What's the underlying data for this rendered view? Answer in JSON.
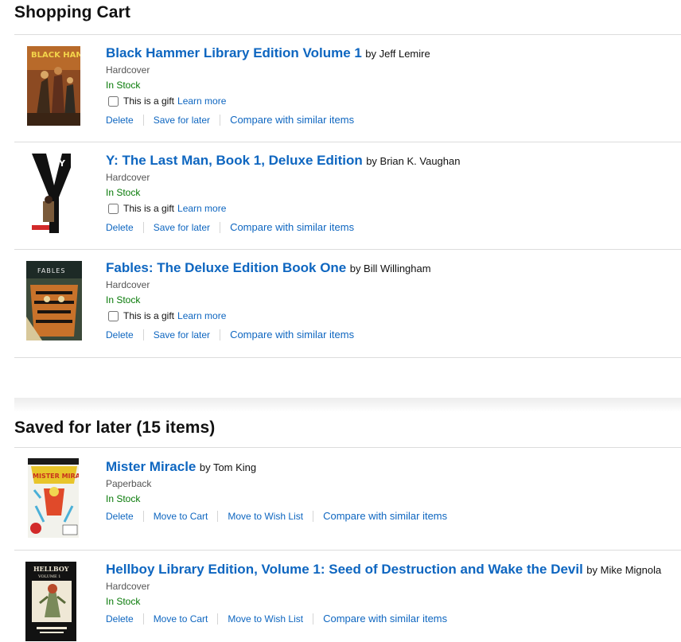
{
  "cart": {
    "heading": "Shopping Cart",
    "items": [
      {
        "title": "Black Hammer Library Edition Volume 1",
        "author": "by Jeff Lemire",
        "format": "Hardcover",
        "stock": "In Stock",
        "gift_label": "This is a gift",
        "learn_more": "Learn more",
        "delete": "Delete",
        "save_later": "Save for later",
        "compare": "Compare with similar items"
      },
      {
        "title": "Y: The Last Man, Book 1, Deluxe Edition",
        "author": "by Brian K. Vaughan",
        "format": "Hardcover",
        "stock": "In Stock",
        "gift_label": "This is a gift",
        "learn_more": "Learn more",
        "delete": "Delete",
        "save_later": "Save for later",
        "compare": "Compare with similar items"
      },
      {
        "title": "Fables: The Deluxe Edition Book One",
        "author": "by Bill Willingham",
        "format": "Hardcover",
        "stock": "In Stock",
        "gift_label": "This is a gift",
        "learn_more": "Learn more",
        "delete": "Delete",
        "save_later": "Save for later",
        "compare": "Compare with similar items"
      }
    ]
  },
  "saved": {
    "heading": "Saved for later (15 items)",
    "items": [
      {
        "title": "Mister Miracle",
        "author": "by Tom King",
        "format": "Paperback",
        "stock": "In Stock",
        "delete": "Delete",
        "move_cart": "Move to Cart",
        "move_wish": "Move to Wish List",
        "compare": "Compare with similar items"
      },
      {
        "title": "Hellboy Library Edition, Volume 1: Seed of Destruction and Wake the Devil",
        "author": "by Mike Mignola",
        "format": "Hardcover",
        "stock": "In Stock",
        "delete": "Delete",
        "move_cart": "Move to Cart",
        "move_wish": "Move to Wish List",
        "compare": "Compare with similar items"
      }
    ]
  },
  "covers": {
    "black_hammer": "BLACK HAMMER",
    "y_last_man": "Y",
    "fables": "FABLES",
    "mister_miracle": "MISTER MIRACLE",
    "hellboy": "HELLBOY",
    "hellboy_volume": "VOLUME 1"
  },
  "colors": {
    "link": "#0e66c0",
    "in_stock": "#087a08",
    "divider": "#dcdcdc"
  }
}
